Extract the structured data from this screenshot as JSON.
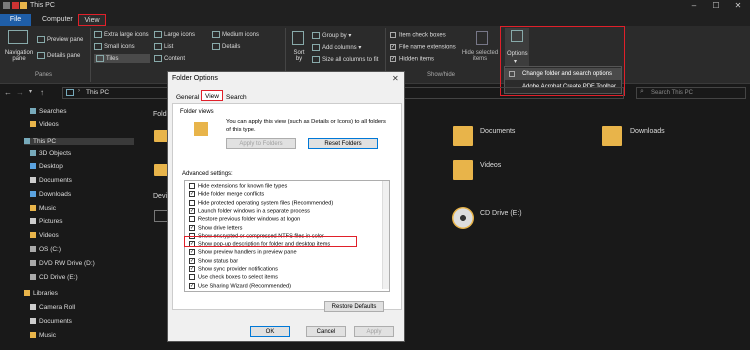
{
  "window": {
    "title": "This PC",
    "controls": [
      "–",
      "☐",
      "✕"
    ]
  },
  "ribbon_tabs": [
    "File",
    "Computer",
    "View"
  ],
  "ribbon": {
    "navigation_pane": "Navigation pane",
    "preview_pane": "Preview pane",
    "details_pane": "Details pane",
    "panes_group": "Panes",
    "layout": [
      "Extra large icons",
      "Large icons",
      "Medium icons",
      "Small icons",
      "List",
      "Details",
      "Tiles",
      "Content"
    ],
    "sort_by": "Sort by",
    "group_by": "Group by",
    "add_columns": "Add columns",
    "size_all_columns": "Size all columns to fit",
    "item_check_boxes": "Item check boxes",
    "file_name_extensions": "File name extensions",
    "hidden_items": "Hidden items",
    "hide_selected": "Hide selected items",
    "show_hide_group": "Show/hide",
    "options": "Options"
  },
  "options_menu": [
    "Change folder and search options",
    "Adobe Acrobat Create PDF Toolbar"
  ],
  "address": {
    "path": "This PC",
    "search_placeholder": "Search This PC"
  },
  "nav_items": [
    "Searches",
    "Videos",
    "This PC",
    "3D Objects",
    "Desktop",
    "Documents",
    "Downloads",
    "Music",
    "Pictures",
    "Videos",
    "OS (C:)",
    "DVD RW Drive (D:)",
    "CD Drive (E:)",
    "Libraries",
    "Camera Roll",
    "Documents",
    "Music"
  ],
  "content": {
    "section_folders": "Folde",
    "section_devices": "Devi",
    "items": [
      "Documents",
      "Downloads",
      "Videos",
      "CD Drive (E:)"
    ]
  },
  "dialog": {
    "title": "Folder Options",
    "tabs": [
      "General",
      "View",
      "Search"
    ],
    "folder_views_label": "Folder views",
    "folder_views_text": "You can apply this view (such as Details or Icons) to all folders of this type.",
    "apply_to_folders": "Apply to Folders",
    "reset_folders": "Reset Folders",
    "advanced_label": "Advanced settings:",
    "settings": [
      {
        "label": "Hide extensions for known file types",
        "checked": false
      },
      {
        "label": "Hide folder merge conflicts",
        "checked": true
      },
      {
        "label": "Hide protected operating system files (Recommended)",
        "checked": false
      },
      {
        "label": "Launch folder windows in a separate process",
        "checked": true
      },
      {
        "label": "Restore previous folder windows at logon",
        "checked": false
      },
      {
        "label": "Show drive letters",
        "checked": true
      },
      {
        "label": "Show encrypted or compressed NTFS files in color",
        "checked": false
      },
      {
        "label": "Show pop-up description for folder and desktop items",
        "checked": true
      },
      {
        "label": "Show preview handlers in preview pane",
        "checked": true
      },
      {
        "label": "Show status bar",
        "checked": true
      },
      {
        "label": "Show sync provider notifications",
        "checked": true
      },
      {
        "label": "Use check boxes to select items",
        "checked": false
      },
      {
        "label": "Use Sharing Wizard (Recommended)",
        "checked": true
      }
    ],
    "restore_defaults": "Restore Defaults",
    "ok": "OK",
    "cancel": "Cancel",
    "apply": "Apply"
  }
}
